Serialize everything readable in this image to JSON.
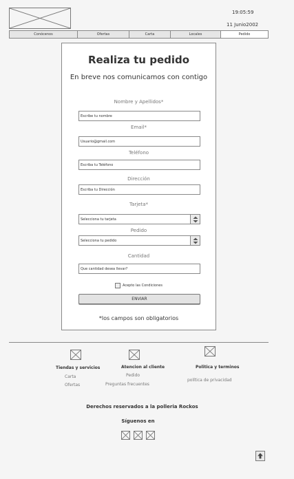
{
  "header": {
    "logo_icon": "image-placeholder-icon",
    "time": "19:05:59",
    "date": "11 Junio2002"
  },
  "nav": {
    "tabs": [
      {
        "label": "Conócenos"
      },
      {
        "label": "Ofertas"
      },
      {
        "label": "Carta"
      },
      {
        "label": "Locales"
      },
      {
        "label": "Pedido"
      }
    ],
    "selected": "Pedido"
  },
  "form": {
    "title": "Realiza tu pedido",
    "subtitle": "En breve nos comunicamos con  contigo",
    "fields": {
      "name": {
        "label": "Nombre y Apellidos*",
        "value": "Escribe tu nombre"
      },
      "email": {
        "label": "Email*",
        "value": "Usuario@gmail.com"
      },
      "phone": {
        "label": "Teléfono",
        "value": "Escriba tu Teléfono"
      },
      "address": {
        "label": "Dirección",
        "value": "Escriba tu Dirección"
      },
      "card": {
        "label": "Tarjeta*",
        "value": "Selecciona tu tarjeta"
      },
      "order": {
        "label": "Pedido",
        "value": "Selecciona tu pedido"
      },
      "quantity": {
        "label": "Cantidad",
        "value": "Que cantidad desea llevar?"
      }
    },
    "terms_label": "Acepto las Condiciones",
    "terms_checked": false,
    "send_label": "ENVIAR",
    "required_note": "*los campos son obligatorios"
  },
  "footer": {
    "columns": [
      {
        "icon": "image-placeholder-icon",
        "title": "Tiendas y servicios",
        "links": [
          "Carta",
          "Ofertas"
        ]
      },
      {
        "icon": "image-placeholder-icon",
        "title": "Atencion al cliente",
        "links": [
          "Pedido",
          "Preguntas frecuentes"
        ]
      },
      {
        "icon": "image-placeholder-icon",
        "title": "Politica y terminos",
        "links": [
          "política de privacidad"
        ]
      }
    ],
    "rights": "Derechos reservados a la polleria Rockos",
    "follow": "Síguenos en",
    "social_icons": [
      "image-placeholder-icon",
      "image-placeholder-icon",
      "image-placeholder-icon"
    ],
    "to_top_icon": "arrow-up-icon"
  }
}
